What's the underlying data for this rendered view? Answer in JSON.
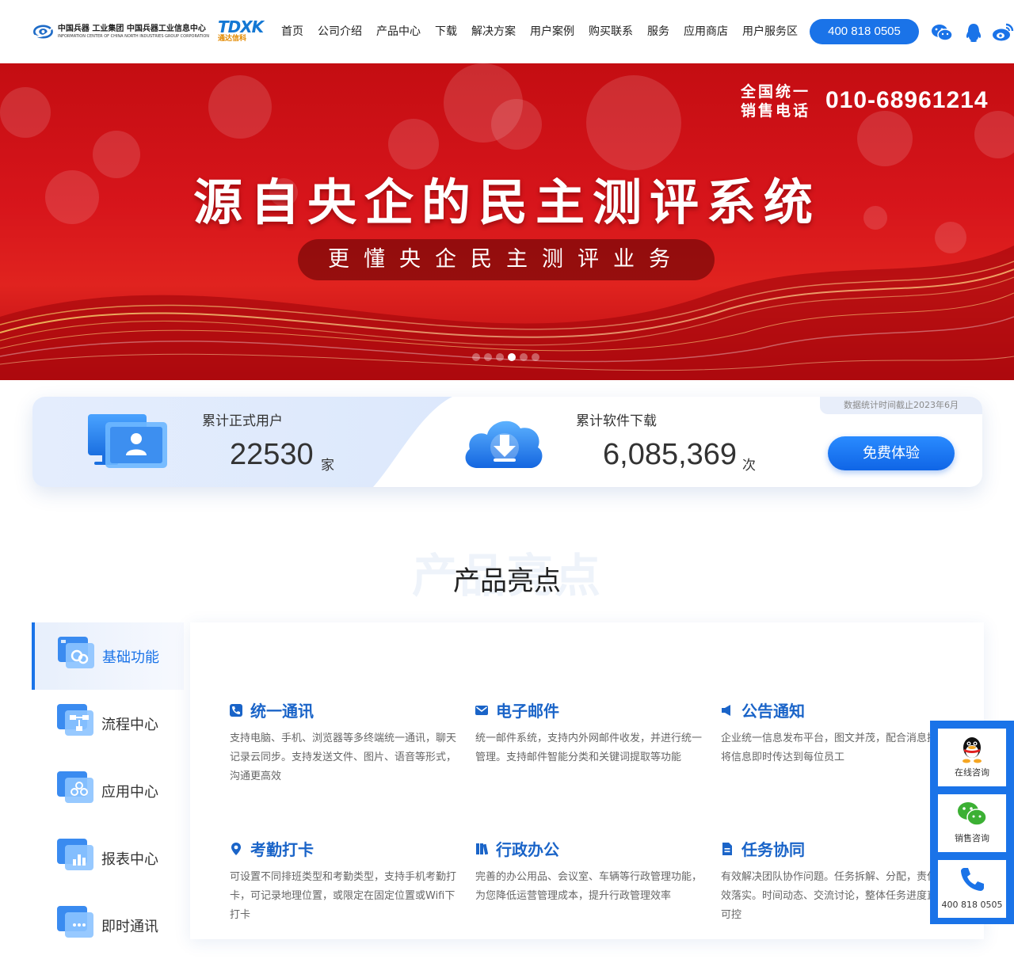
{
  "header": {
    "logo_main": "中国兵器 工业集团",
    "logo_sub": "中国兵器工业信息中心",
    "logo_sub_en": "INFORMATION CENTER OF CHINA NORTH INDUSTRIES GROUP CORPORATION",
    "logo2": "TDXK",
    "logo2_sub": "通达信科",
    "nav": [
      "首页",
      "公司介绍",
      "产品中心",
      "下载",
      "解决方案",
      "用户案例",
      "购买联系",
      "服务",
      "应用商店",
      "用户服务区"
    ],
    "phone": "400 818 0505"
  },
  "banner": {
    "hotline_label_1": "全国统一",
    "hotline_label_2": "销售电话",
    "hotline_number": "010-68961214",
    "title": "源自央企的民主测评系统",
    "subtitle": "更懂央企民主测评业务",
    "slides": 6,
    "active_slide": 4
  },
  "stats": {
    "users_label": "累计正式用户",
    "users_value": "22530",
    "users_unit": "家",
    "downloads_label": "累计软件下载",
    "downloads_value": "6,085,369",
    "downloads_unit": "次",
    "note": "数据统计时间截止2023年6月",
    "trial_button": "免费体验"
  },
  "section": {
    "bg_text": "产品亮点",
    "title": "产品亮点"
  },
  "tabs": [
    "基础功能",
    "流程中心",
    "应用中心",
    "报表中心",
    "即时通讯"
  ],
  "features": [
    {
      "title": "统一通讯",
      "desc": "支持电脑、手机、浏览器等多终端统一通讯，聊天记录云同步。支持发送文件、图片、语音等形式，沟通更高效"
    },
    {
      "title": "电子邮件",
      "desc": "统一邮件系统，支持内外网邮件收发，并进行统一管理。支持邮件智能分类和关键词提取等功能"
    },
    {
      "title": "公告通知",
      "desc": "企业统一信息发布平台，图文并茂，配合消息提醒将信息即时传达到每位员工"
    },
    {
      "title": "考勤打卡",
      "desc": "可设置不同排班类型和考勤类型，支持手机考勤打卡，可记录地理位置，或限定在固定位置或Wifi下打卡"
    },
    {
      "title": "行政办公",
      "desc": "完善的办公用品、会议室、车辆等行政管理功能，为您降低运营管理成本，提升行政管理效率"
    },
    {
      "title": "任务协同",
      "desc": "有效解决团队协作问题。任务拆解、分配，责任有效落实。时间动态、交流讨论，整体任务进度直观可控"
    }
  ],
  "float": {
    "online": "在线咨询",
    "sales": "销售咨询",
    "phone": "400 818 0505"
  },
  "colors": {
    "accent": "#1a73e8",
    "banner_red": "#d7151b",
    "feature_title": "#1a64c8"
  }
}
